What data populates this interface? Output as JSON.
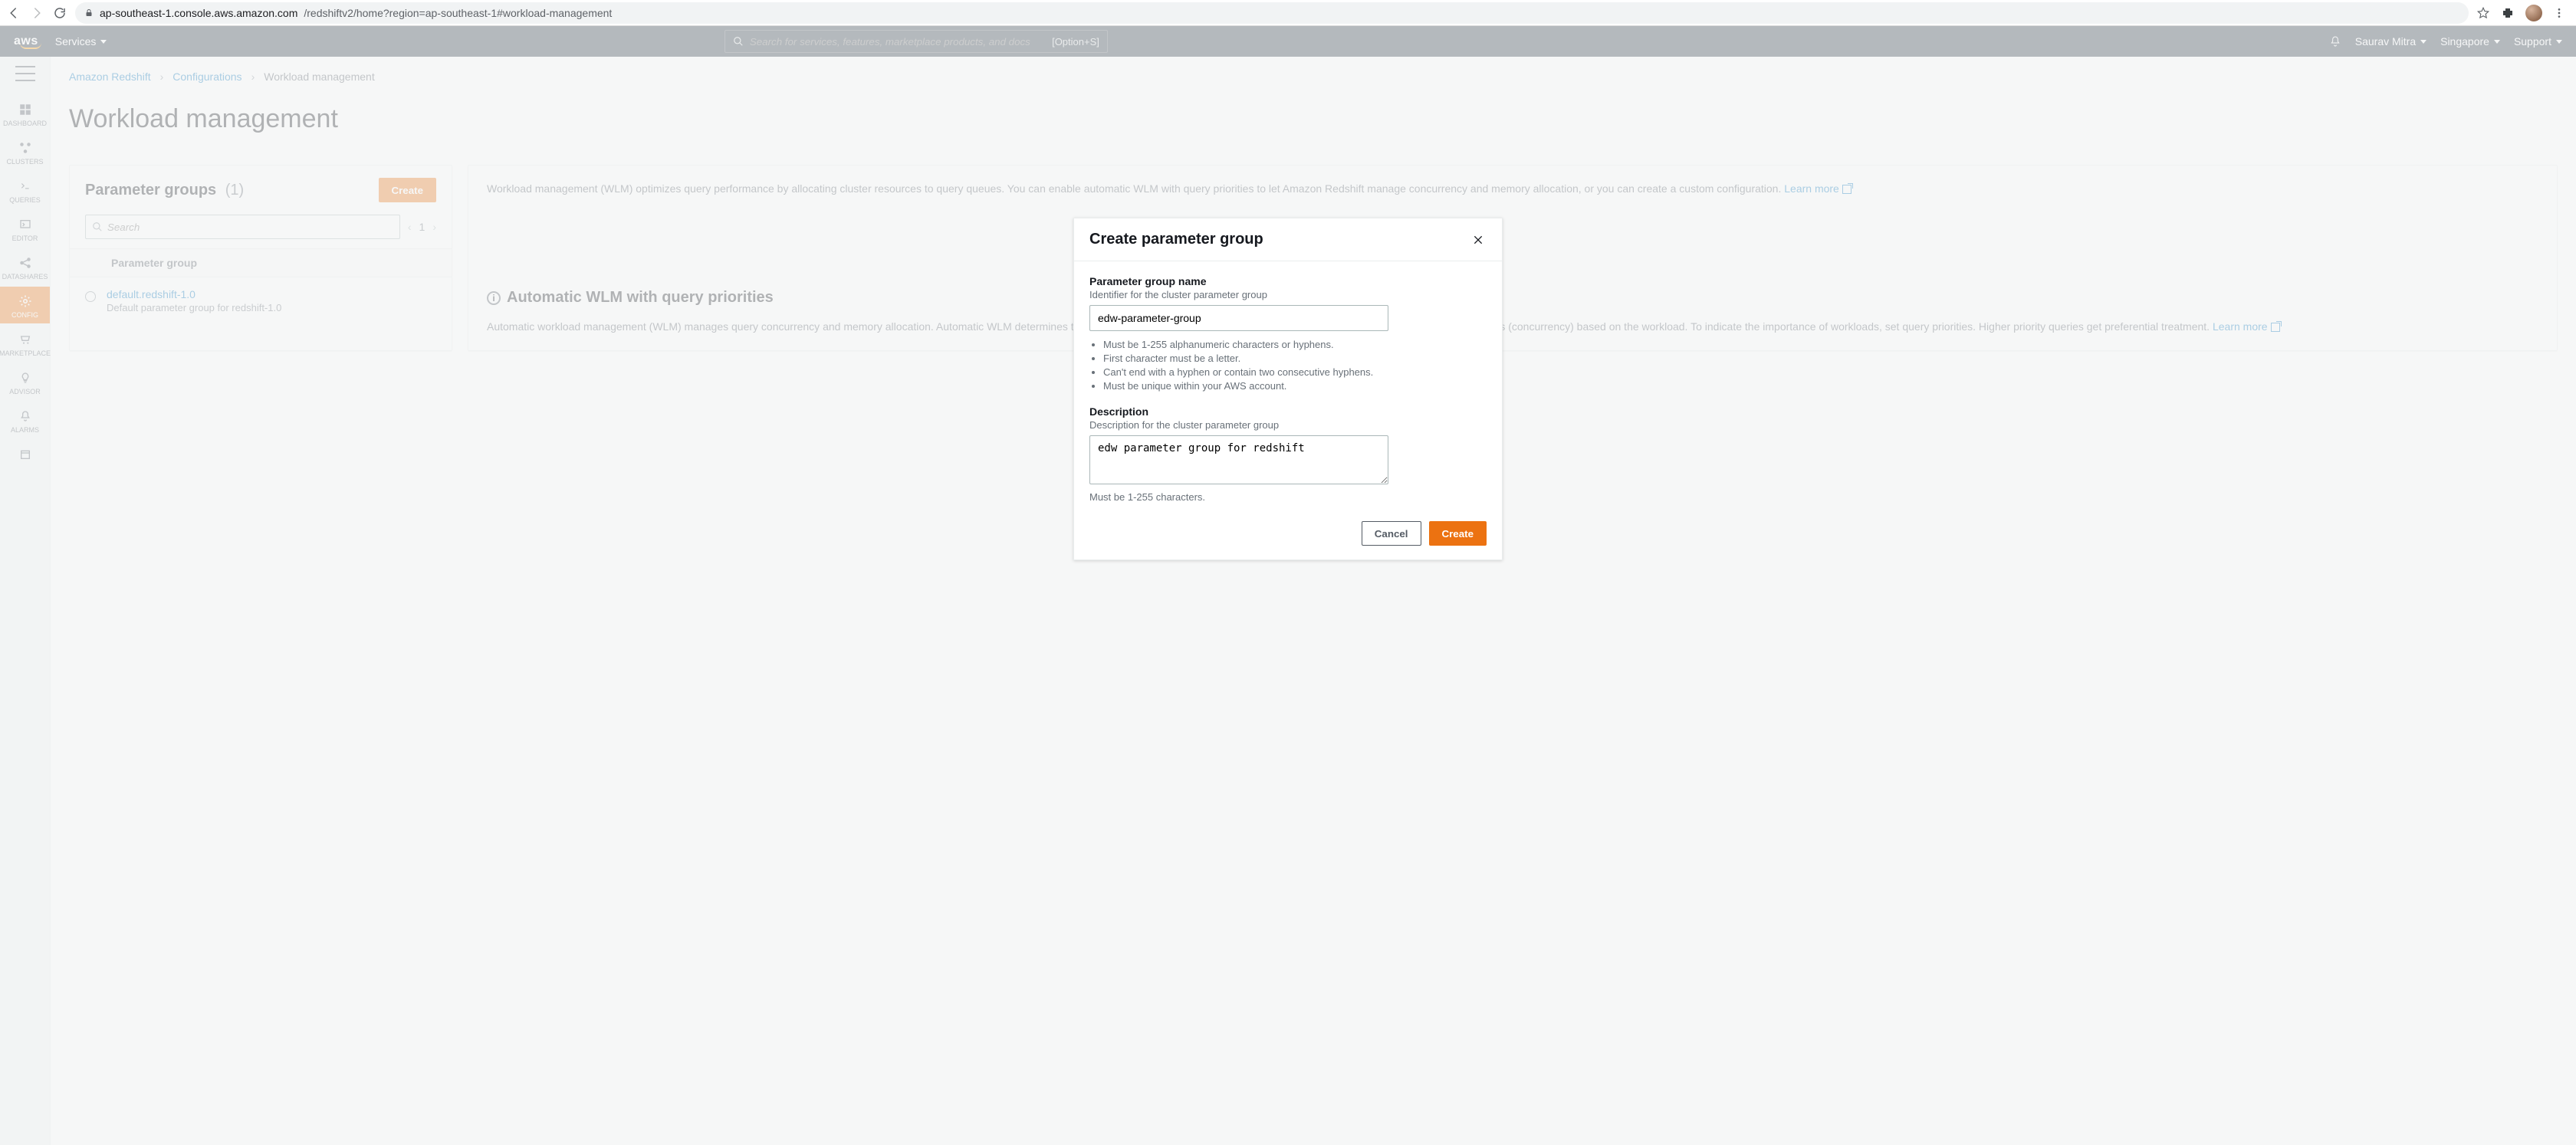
{
  "browser": {
    "url_host": "ap-southeast-1.console.aws.amazon.com",
    "url_path": "/redshiftv2/home?region=ap-southeast-1#workload-management"
  },
  "aws_nav": {
    "logo": "aws",
    "services": "Services",
    "search_placeholder": "Search for services, features, marketplace products, and docs",
    "shortcut": "[Option+S]",
    "user": "Saurav Mitra",
    "region": "Singapore",
    "support": "Support"
  },
  "leftnav": {
    "items": [
      {
        "label": "DASHBOARD"
      },
      {
        "label": "CLUSTERS"
      },
      {
        "label": "QUERIES"
      },
      {
        "label": "EDITOR"
      },
      {
        "label": "DATASHARES"
      },
      {
        "label": "CONFIG"
      },
      {
        "label": "MARKETPLACE"
      },
      {
        "label": "ADVISOR"
      },
      {
        "label": "ALARMS"
      }
    ]
  },
  "breadcrumb": {
    "a": "Amazon Redshift",
    "b": "Configurations",
    "c": "Workload management"
  },
  "page": {
    "title": "Workload management"
  },
  "param_panel": {
    "title": "Parameter groups",
    "count": "(1)",
    "create": "Create",
    "search_placeholder": "Search",
    "page": "1",
    "col": "Parameter group",
    "row_title": "default.redshift-1.0",
    "row_desc": "Default parameter group for redshift-1.0"
  },
  "info_panel": {
    "intro": "Workload management (WLM) optimizes query performance by allocating cluster resources to query queues. You can enable automatic WLM with query priorities to let Amazon Redshift manage concurrency and memory allocation, or you can create a custom configuration.  ",
    "learn": "Learn more",
    "title": "Automatic WLM with query priorities",
    "body": "Automatic workload management (WLM) manages query concurrency and memory allocation. Automatic WLM determines the amount of resources that queries need. It adjusts the number of parallel running queries (concurrency) based on the workload. To indicate the importance of workloads, set query priorities. Higher priority queries get preferential treatment.  ",
    "learn2": "Learn more"
  },
  "modal": {
    "title": "Create parameter group",
    "name_label": "Parameter group name",
    "name_hint": "Identifier for the cluster parameter group",
    "name_value": "edw-parameter-group",
    "rules": [
      "Must be 1-255 alphanumeric characters or hyphens.",
      "First character must be a letter.",
      "Can't end with a hyphen or contain two consecutive hyphens.",
      "Must be unique within your AWS account."
    ],
    "desc_label": "Description",
    "desc_hint": "Description for the cluster parameter group",
    "desc_value": "edw parameter group for redshift",
    "desc_rule": "Must be 1-255 characters.",
    "cancel": "Cancel",
    "create": "Create"
  }
}
